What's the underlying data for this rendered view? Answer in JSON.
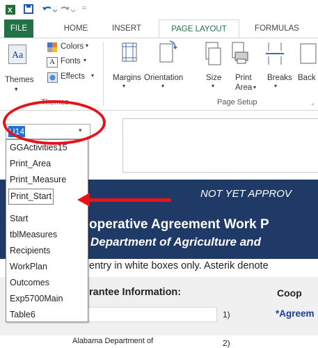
{
  "ribbon_tabs": {
    "file": "FILE",
    "home": "HOME",
    "insert": "INSERT",
    "page_layout": "PAGE LAYOUT",
    "formulas": "FORMULAS"
  },
  "themes_group": {
    "themes": "Themes",
    "colors": "Colors",
    "fonts": "Fonts",
    "effects": "Effects",
    "label": "Themes"
  },
  "page_setup_group": {
    "margins": "Margins",
    "orientation": "Orientation",
    "size": "Size",
    "print_area": "Print",
    "print_area_2": "Area",
    "breaks": "Breaks",
    "background": "Back",
    "label": "Page Setup"
  },
  "name_box": {
    "value": "U14"
  },
  "name_list": [
    "GGActivities15",
    "Print_Area",
    "Print_Measure",
    "Print_Start",
    "Start",
    "tblMeasures",
    "Recipients",
    "WorkPlan",
    "Outcomes",
    "Exp5700Main",
    "Table6"
  ],
  "sheet": {
    "not_yet_approved": "NOT YET APPROV",
    "title_line1": "operative Agreement Work P",
    "title_line2": "Department of Agriculture and",
    "instructions": "entry in white boxes only. Asterik denote",
    "grantee_info": "rantee Information:",
    "coop": "Coop",
    "row1_num": "1)",
    "agreem": "*Agreem",
    "alabama": "Alabama Department of",
    "row2_num": "2)"
  },
  "colors": {
    "excel_green": "#217346",
    "banner_navy": "#1f3a67",
    "highlight_blue": "#1f6fd6",
    "annotation_red": "#e8121a"
  }
}
